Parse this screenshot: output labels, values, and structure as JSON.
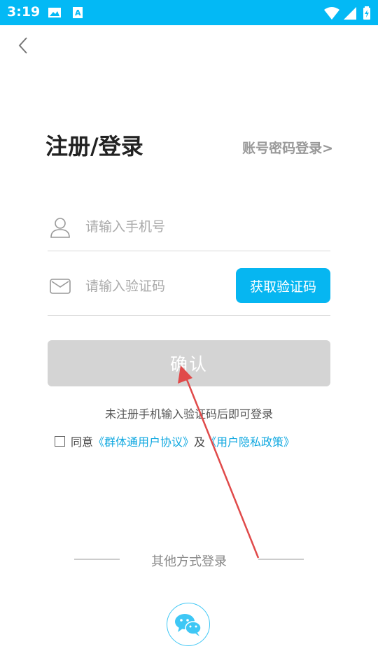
{
  "status_bar": {
    "time": "3:19"
  },
  "header": {
    "title": "注册/登录",
    "password_login": "账号密码登录>"
  },
  "form": {
    "phone_placeholder": "请输入手机号",
    "code_placeholder": "请输入验证码",
    "get_code_button": "获取验证码",
    "confirm_button": "确认"
  },
  "hint": "未注册手机输入验证码后即可登录",
  "agreement": {
    "prefix": "同意",
    "user_agreement": "《群体通用户协议》",
    "and": "及",
    "privacy_policy": "《用户隐私政策》"
  },
  "other_login": {
    "label": "其他方式登录",
    "wechat_icon": "wechat-icon"
  },
  "colors": {
    "status_bar": "#03b9f5",
    "accent": "#06b6f1",
    "confirm_disabled": "#d4d4d4",
    "annotation_arrow": "#e04a4a"
  }
}
